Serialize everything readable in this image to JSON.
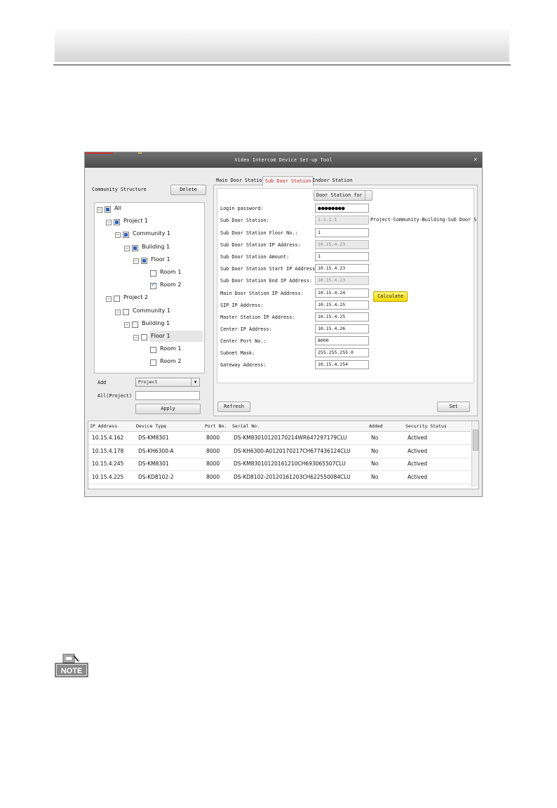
{
  "window": {
    "title": "Video Intercom Device Set-up Tool",
    "close_glyph": "×"
  },
  "left": {
    "heading": "Community Structure",
    "delete_label": "Delete",
    "tree": [
      {
        "label": "All",
        "state": "partial",
        "expander": "−"
      },
      {
        "label": "Project 1",
        "state": "partial",
        "expander": "−"
      },
      {
        "label": "Community 1",
        "state": "partial",
        "expander": "−"
      },
      {
        "label": "Building 1",
        "state": "partial",
        "expander": "−"
      },
      {
        "label": "Floor 1",
        "state": "partial",
        "expander": "−"
      },
      {
        "label": "Room 1",
        "state": "unchecked",
        "expander": ""
      },
      {
        "label": "Room 2",
        "state": "checked",
        "expander": ""
      },
      {
        "label": "Project 2",
        "state": "unchecked",
        "expander": "−"
      },
      {
        "label": "Community 1",
        "state": "unchecked",
        "expander": "−"
      },
      {
        "label": "Building 1",
        "state": "unchecked",
        "expander": "−"
      },
      {
        "label": "Floor 1",
        "state": "unchecked",
        "expander": "−"
      },
      {
        "label": "Room 1",
        "state": "unchecked",
        "expander": ""
      },
      {
        "label": "Room 2",
        "state": "unchecked",
        "expander": ""
      }
    ],
    "add_label": "Add",
    "add_value": "Project",
    "all_project_label": "All(Project)",
    "all_project_value": "",
    "apply_label": "Apply"
  },
  "tabs": {
    "main": "Main Door Station",
    "sub": "Sub Door Station",
    "indoor": "Indoor Station"
  },
  "form": {
    "door_station_for": "Door Station for",
    "fields": [
      {
        "label": "Login password:",
        "value": "●●●●●●●●",
        "disabled": false
      },
      {
        "label": "Sub Door Station:",
        "value": "1-1-1-1",
        "disabled": true
      },
      {
        "label": "Sub Door Station Floor No.:",
        "value": "1",
        "disabled": false
      },
      {
        "label": "Sub Door Station IP Address:",
        "value": "10.15.4.23",
        "disabled": true
      },
      {
        "label": "Sub Door Station Amount:",
        "value": "1",
        "disabled": false
      },
      {
        "label": "Sub Door Station Start IP Address:",
        "value": "10.15.4.23",
        "disabled": false
      },
      {
        "label": "Sub Door Station End IP Address:",
        "value": "10.15.4.23",
        "disabled": true
      },
      {
        "label": "Main Door Station IP Address:",
        "value": "10.15.4.24",
        "disabled": false
      },
      {
        "label": "SIP IP Address:",
        "value": "10.15.4.25",
        "disabled": false
      },
      {
        "label": "Master Station IP Address:",
        "value": "10.15.4.25",
        "disabled": false
      },
      {
        "label": "Center IP Address:",
        "value": "10.15.4.26",
        "disabled": false
      },
      {
        "label": "Center Port No.:",
        "value": "8000",
        "disabled": false
      },
      {
        "label": "Subnet Mask:",
        "value": "255.255.255.0",
        "disabled": false
      },
      {
        "label": "Gateway Address:",
        "value": "10.15.4.254",
        "disabled": false
      }
    ],
    "hint": "Project-Community-Building-Sub Door S",
    "calculate_label": "Calculate",
    "refresh_label": "Refresh",
    "set_label": "Set"
  },
  "grid": {
    "columns": [
      "IP Address",
      "Device Type",
      "Port No.",
      "Serial No.",
      "Added",
      "Security Status"
    ],
    "rows": [
      [
        "10.15.4.162",
        "DS-KM8301",
        "8000",
        "DS-KM83010120170214WR647297179CLU",
        "No",
        "Actived"
      ],
      [
        "10.15.4.178",
        "DS-KH6300-A",
        "8000",
        "DS-KH6300-A0120170217CH677436124CLU",
        "No",
        "Actived"
      ],
      [
        "10.15.4.245",
        "DS-KM8301",
        "8000",
        "DS-KM83010120161210CH693065507CLU",
        "No",
        "Actived"
      ],
      [
        "10.15.4.225",
        "DS-KD8102-2",
        "8000",
        "DS-KD8102-20120161203CH622550084CLU",
        "No",
        "Actived"
      ]
    ]
  },
  "note": {
    "label": "NOTE"
  }
}
